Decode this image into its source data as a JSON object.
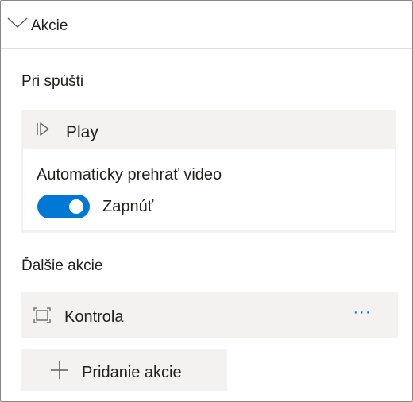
{
  "header": {
    "title": "Akcie",
    "icon": "chevron-down-icon"
  },
  "on_start": {
    "section_label": "Pri spúšti",
    "action": {
      "icon": "play-icon",
      "name": "Play"
    },
    "setting": {
      "label": "Automaticky prehrať video",
      "toggle_state": "on",
      "toggle_text": "Zapnúť"
    }
  },
  "more_actions": {
    "section_label": "Ďalšie akcie",
    "items": [
      {
        "icon": "fullscreen-control-icon",
        "label": "Kontrola",
        "more_label": "···"
      }
    ]
  },
  "add_action": {
    "icon": "plus-icon",
    "label": "Pridanie akcie"
  },
  "colors": {
    "accent": "#0078d4",
    "card_bg": "#f3f2f1",
    "border": "#8a8886",
    "text": "#201f1e"
  }
}
